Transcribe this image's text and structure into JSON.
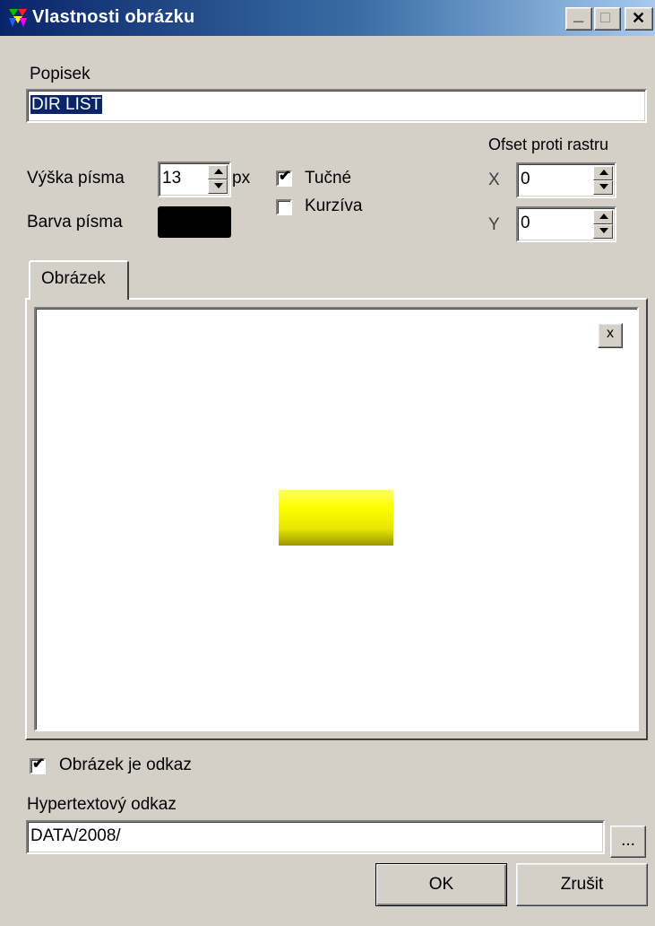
{
  "window": {
    "title": "Vlastnosti obrázku",
    "icon": "app-icon",
    "controls": [
      "minimize-icon",
      "maximize-icon",
      "close-icon"
    ],
    "control_glyphs": {
      "minimize": "_",
      "maximize": "□",
      "close": "✕"
    }
  },
  "caption": {
    "label": "Popisek",
    "value": "DIR LIST"
  },
  "font": {
    "size_label": "Výška písma",
    "size_value": "13",
    "size_unit": "px",
    "color_label": "Barva písma",
    "color_value": "#000000",
    "bold_label": "Tučné",
    "bold_checked": true,
    "italic_label": "Kurzíva",
    "italic_checked": false
  },
  "offset": {
    "label": "Ofset proti rastru",
    "x_label": "X",
    "x_value": "0",
    "y_label": "Y",
    "y_value": "0"
  },
  "tabs": [
    {
      "label": "Obrázek",
      "active": true
    }
  ],
  "preview": {
    "remove_label": "x",
    "image_color": "#ffff00"
  },
  "link": {
    "is_link_label": "Obrázek je odkaz",
    "is_link_checked": true,
    "url_label": "Hypertextový odkaz",
    "url_value": "DATA/2008/",
    "browse_label": "..."
  },
  "buttons": {
    "ok": "OK",
    "cancel": "Zrušit"
  }
}
